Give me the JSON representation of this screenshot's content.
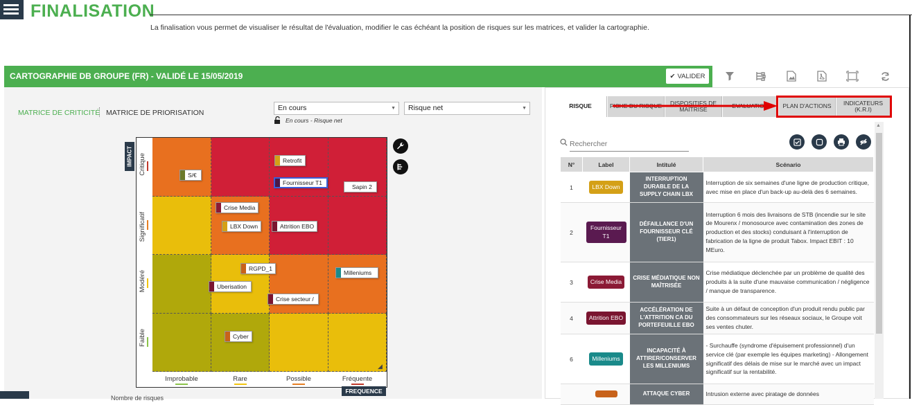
{
  "header": {
    "title": "FINALISATION",
    "intro": "La finalisation vous permet de visualiser le résultat de l'évaluation, modifier le cas échéant la position de risques sur les matrices, et valider la cartographie."
  },
  "toolbar": {
    "carto_title": "CARTOGRAPHIE DB GROUPE (FR) - VALIDÉ LE 15/05/2019",
    "valider_label": "VALIDER",
    "icons": [
      "filter-icon",
      "tree-icon",
      "image-export-icon",
      "pdf-icon",
      "fullscreen-icon",
      "refresh-icon"
    ]
  },
  "matrix_panel": {
    "tab_criticite": "MATRICE DE CRITICITÉ",
    "tab_priorisation": "MATRICE DE PRIORISATION",
    "select_status": "En cours",
    "select_type": "Risque net",
    "state_caption": "En cours - Risque net",
    "impact_tag": "IMPACT",
    "frequence_tag": "FREQUENCE",
    "rows": [
      {
        "label": "Critique",
        "mark": "#c0392b"
      },
      {
        "label": "Significatif",
        "mark": "#e67e22"
      },
      {
        "label": "Modéré",
        "mark": "#f1c40f"
      },
      {
        "label": "Faible",
        "mark": "#8bc34a"
      }
    ],
    "columns": [
      {
        "label": "Improbable",
        "mark": "#8bc34a"
      },
      {
        "label": "Rare",
        "mark": "#f1c40f"
      },
      {
        "label": "Possible",
        "mark": "#e67e22"
      },
      {
        "label": "Fréquente",
        "mark": "#c0392b"
      }
    ],
    "cell_colors": [
      [
        "#e8701f",
        "#d01f37",
        "#d01f37",
        "#d01f37"
      ],
      [
        "#e9be0b",
        "#e8701f",
        "#d01f37",
        "#d01f37"
      ],
      [
        "#b0a80b",
        "#e9be0b",
        "#e8701f",
        "#e8701f"
      ],
      [
        "#b0a80b",
        "#b0a80b",
        "#e9be0b",
        "#e9be0b"
      ]
    ],
    "risks": [
      {
        "label": "S/€",
        "color": "#6b7a2a"
      },
      {
        "label": "Retrofit",
        "color": "#d4a017"
      },
      {
        "label": "Fournisseur T1",
        "color": "#4a1848"
      },
      {
        "label": "Sapin 2",
        "color": "#ffffff"
      },
      {
        "label": "Crise Media",
        "color": "#8b1a35"
      },
      {
        "label": "LBX Down",
        "color": "#d4a017"
      },
      {
        "label": "Attrition EBO",
        "color": "#7a1530"
      },
      {
        "label": "RGPD_1",
        "color": "#c8621a"
      },
      {
        "label": "Milleniums",
        "color": "#1a8a8a"
      },
      {
        "label": "Uberisation",
        "color": "#7a1530"
      },
      {
        "label": "Crise secteur /",
        "color": "#7a1530"
      },
      {
        "label": "Cyber",
        "color": "#c8621a"
      }
    ]
  },
  "detail_panel": {
    "tabs": [
      "RISQUE",
      "FICHE DU RISQUE",
      "DISPOSITIFS DE MAÎTRISE",
      "EVALUATION",
      "PLAN D'ACTIONS",
      "INDICATEURS (K.R.I)"
    ],
    "search_placeholder": "Rechercher",
    "columns": [
      "N°",
      "Label",
      "Intitulé",
      "Scénario"
    ],
    "rows": [
      {
        "num": "1",
        "label": "LBX Down",
        "color": "#d4a017",
        "intitule": "INTERRUPTION DURABLE DE LA SUPPLY CHAIN LBX",
        "scenario": "Interruption de six semaines d'une ligne de production critique, avec mise en place d'un back-up au-delà des 6 semaines."
      },
      {
        "num": "2",
        "label": "Fournisseur T1",
        "color": "#5a1a50",
        "intitule": "DÉFAILLANCE D'UN FOURNISSEUR CLÉ (TIER1)",
        "scenario": "Interruption 6 mois des livraisons de STB (incendie sur le site de Mourenx / monosource avec contamination des zones de production et des stocks) conduisant à l'interruption de fabrication de la ligne de produit Tabox. Impact EBIT : 10 MEuro."
      },
      {
        "num": "3",
        "label": "Crise Media",
        "color": "#8b1a35",
        "intitule": "CRISE MÉDIATIQUE NON MAÎTRISÉE",
        "scenario": "Crise médiatique déclenchée par un problème de qualité des produits à la suite d'une mauvaise communication / négligence / manque de transparence."
      },
      {
        "num": "4",
        "label": "Attrition EBO",
        "color": "#7a1530",
        "intitule": "ACCÉLÉRATION DE L'ATTRITION CA DU PORTEFEUILLE EBO",
        "scenario": "Suite à un défaut de conception d'un produit rendu public par des consommateurs sur les réseaux sociaux, le Groupe voit ses ventes chuter."
      },
      {
        "num": "6",
        "label": "Milleniums",
        "color": "#1a8a8a",
        "intitule": "INCAPACITÉ À ATTIRER/CONSERVER LES MILLENIUMS",
        "scenario": "- Surchauffe (syndrome d'épuisement professionnel) d'un service clé (par exemple les équipes marketing) - Allongement significatif des délais de mise sur le marché avec un impact significatif sur la rentabilité."
      },
      {
        "num": "",
        "label": "",
        "color": "#c8621a",
        "intitule": "ATTAQUE CYBER",
        "scenario": "Intrusion externe avec piratage de données"
      }
    ]
  },
  "footer": {
    "partial_text": "Nombre de risques"
  }
}
